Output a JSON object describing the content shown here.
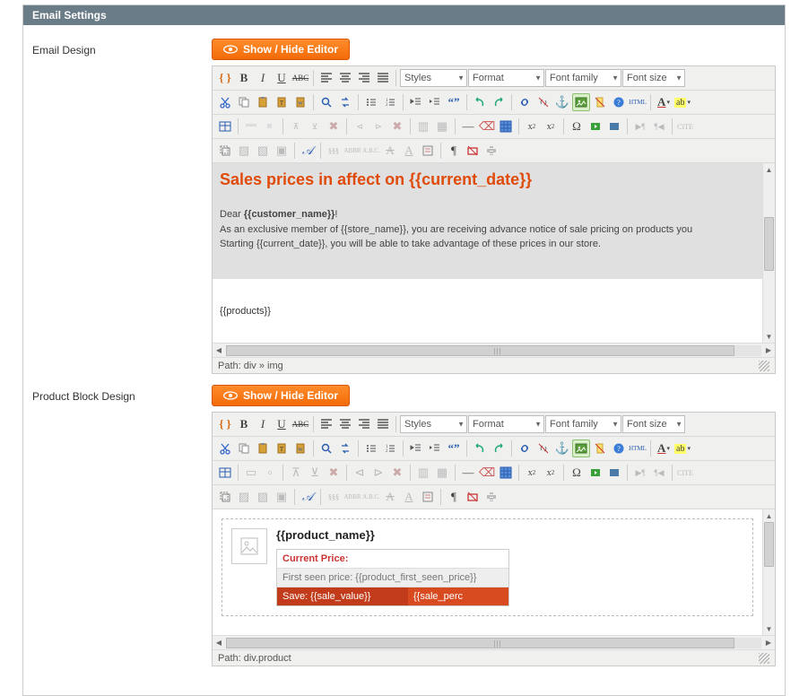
{
  "panel": {
    "title": "Email Settings"
  },
  "labels": {
    "email_design": "Email Design",
    "product_block_design": "Product Block Design"
  },
  "buttons": {
    "show_hide_editor": "Show / Hide Editor"
  },
  "toolbar_selects": {
    "styles": "Styles",
    "format": "Format",
    "font_family": "Font family",
    "font_size": "Font size"
  },
  "editor1": {
    "title": "Sales prices in affect on {{current_date}}",
    "line_dear": "Dear {{customer_name}}!",
    "line_member": "As an exclusive member of {{store_name}}, you are receiving advance notice of sale pricing on products you",
    "line_starting": "Starting {{current_date}}, you will be able to take advantage of these prices in our store.",
    "products_token": "{{products}}",
    "status_path": "Path: div » img"
  },
  "editor2": {
    "product_name": "{{product_name}}",
    "current_price_label": "Current Price:",
    "first_seen": "First seen price: {{product_first_seen_price}}",
    "save_value": "Save: {{sale_value}}",
    "save_percent": "{{sale_perc",
    "status_path": "Path: div.product"
  },
  "glyphs": {
    "bold": "B",
    "italic": "I",
    "underline": "U",
    "strike": "ABC",
    "quote": "“”",
    "omega": "Ω",
    "pilcrow": "¶",
    "anchor": "⚓",
    "script_a": "𝒜"
  }
}
